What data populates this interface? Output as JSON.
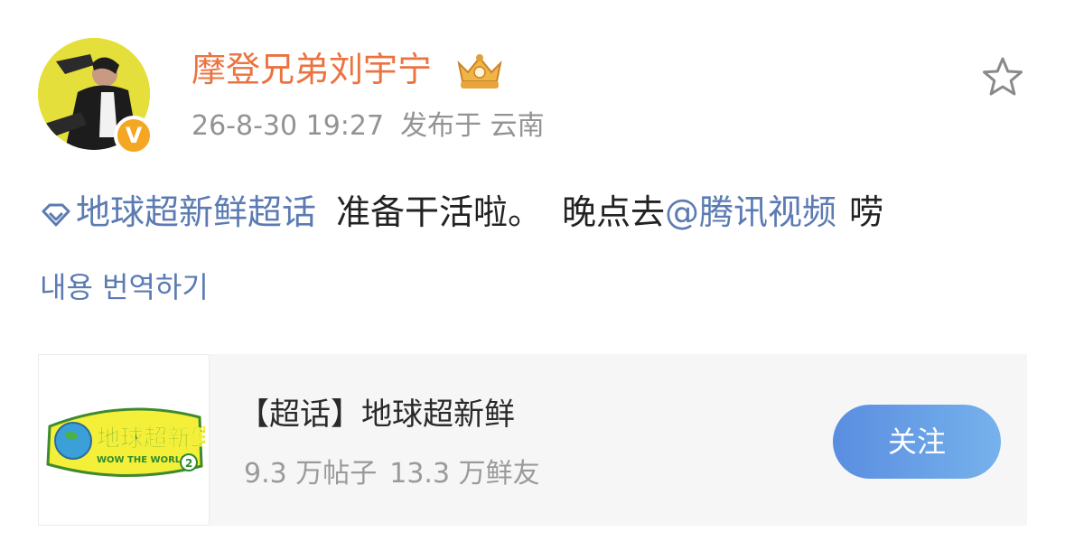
{
  "post": {
    "username": "摩登兄弟刘宇宁",
    "time": "26-8-30 19:27",
    "location": "发布于 云南",
    "verified_mark": "V",
    "topic": "地球超新鲜超话",
    "text_1": "准备干活啦。",
    "text_2": "晚点去",
    "mention": "@腾讯视频",
    "text_3": "唠",
    "translate": "내용 번역하기"
  },
  "card": {
    "title": "【超话】地球超新鲜",
    "posts": "9.3 万帖子",
    "fans": "13.3 万鲜友",
    "follow": "关注",
    "logo_text": "地球超新鲜",
    "logo_sub": "WOW THE WORLD",
    "logo_num": "2"
  },
  "colors": {
    "username": "#eb7340",
    "link": "#5b7bb2",
    "meta": "#939393",
    "button_start": "#5a8de0",
    "button_end": "#76b2ec",
    "card_bg": "#f6f6f6"
  },
  "icons": {
    "avatar": "user-avatar",
    "badge": "crown-badge-icon",
    "favorite": "star-outline-icon",
    "topic": "diamond-topic-icon"
  }
}
